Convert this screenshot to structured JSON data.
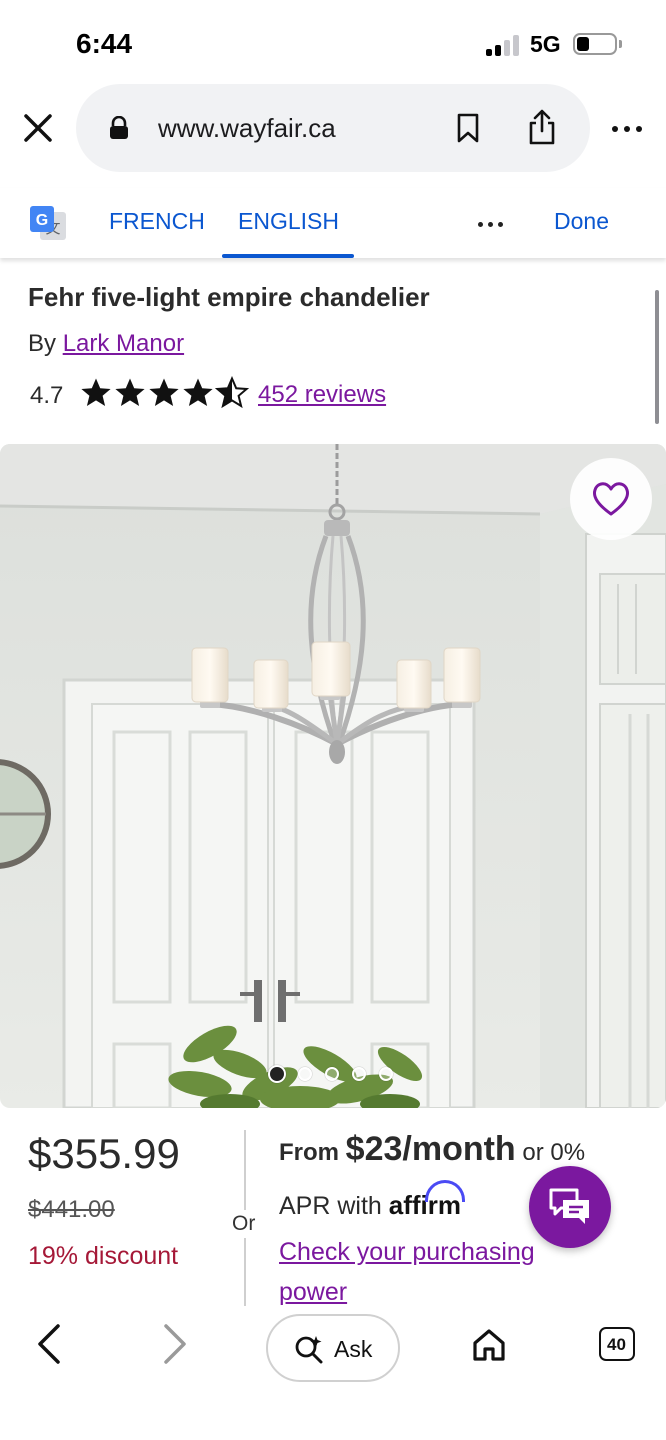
{
  "status_bar": {
    "time": "6:44",
    "network": "5G"
  },
  "browser": {
    "url": "www.wayfair.ca",
    "icons": [
      "close-icon",
      "lock-icon",
      "bookmark-icon",
      "share-icon",
      "more-icon"
    ]
  },
  "translate_bar": {
    "source_language": "FRENCH",
    "target_language": "ENGLISH",
    "selected": "ENGLISH",
    "done_label": "Done"
  },
  "product": {
    "title": "Fehr five-light empire chandelier",
    "by_prefix": "By",
    "brand": "Lark Manor",
    "rating": "4.7",
    "stars_value": 4.7,
    "reviews_label": "452 reviews",
    "carousel_count": 5,
    "carousel_index": 1
  },
  "pricing": {
    "price": "$355.99",
    "original_price": "$441.00",
    "discount": "19% discount",
    "or_label": "Or",
    "financing": {
      "from_label": "From",
      "monthly": "$23/month",
      "rate": "or 0%",
      "apr_label": "APR with",
      "provider": "affirm",
      "cta": "Check your purchasing power"
    }
  },
  "toolbar": {
    "ask_label": "Ask",
    "tab_count": "40"
  },
  "colors": {
    "accent_purple": "#7b189f",
    "translate_blue": "#0b57d0",
    "discount_red": "#a51837",
    "affirm_blue": "#4a4af4"
  }
}
